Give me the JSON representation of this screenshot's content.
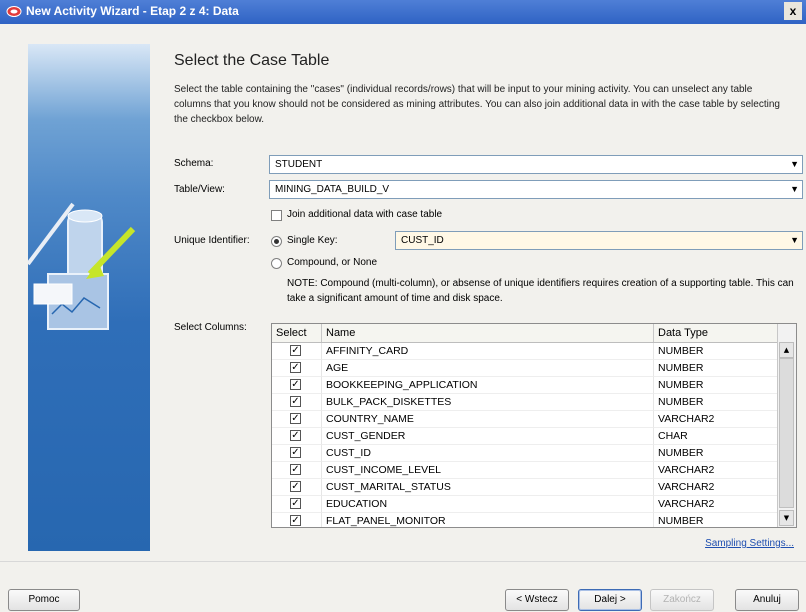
{
  "window": {
    "title": "New Activity Wizard - Etap 2 z 4: Data",
    "close_glyph": "x"
  },
  "heading": "Select the Case Table",
  "description": "Select the table containing the \"cases\" (individual records/rows) that will be input to your mining activity.  You can unselect any table columns that you know should not be considered as mining attributes.  You can also join additional data in with the case table by selecting the checkbox below.",
  "schema": {
    "label": "Schema:",
    "value": "STUDENT"
  },
  "table_view": {
    "label": "Table/View:",
    "value": "MINING_DATA_BUILD_V"
  },
  "join": {
    "label": "Join additional data with case table",
    "checked": false
  },
  "unique_identifier": {
    "label": "Unique Identifier:",
    "single_key_label": "Single Key:",
    "single_key_value": "CUST_ID",
    "compound_label": "Compound, or None",
    "selected": "single_key",
    "note": "NOTE: Compound (multi-column), or absense of unique identifiers requires creation of a supporting table. This can take a significant amount of time and disk space."
  },
  "select_columns": {
    "label": "Select Columns:",
    "headers": [
      "Select",
      "Name",
      "Data Type"
    ],
    "rows": [
      {
        "name": "AFFINITY_CARD",
        "type": "NUMBER",
        "selected": true
      },
      {
        "name": "AGE",
        "type": "NUMBER",
        "selected": true
      },
      {
        "name": "BOOKKEEPING_APPLICATION",
        "type": "NUMBER",
        "selected": true
      },
      {
        "name": "BULK_PACK_DISKETTES",
        "type": "NUMBER",
        "selected": true
      },
      {
        "name": "COUNTRY_NAME",
        "type": "VARCHAR2",
        "selected": true
      },
      {
        "name": "CUST_GENDER",
        "type": "CHAR",
        "selected": true
      },
      {
        "name": "CUST_ID",
        "type": "NUMBER",
        "selected": true
      },
      {
        "name": "CUST_INCOME_LEVEL",
        "type": "VARCHAR2",
        "selected": true
      },
      {
        "name": "CUST_MARITAL_STATUS",
        "type": "VARCHAR2",
        "selected": true
      },
      {
        "name": "EDUCATION",
        "type": "VARCHAR2",
        "selected": true
      },
      {
        "name": "FLAT_PANEL_MONITOR",
        "type": "NUMBER",
        "selected": true
      }
    ]
  },
  "sampling_link": "Sampling Settings...",
  "buttons": {
    "help": "Pomoc",
    "back": "< Wstecz",
    "next": "Dalej >",
    "finish": "Zakończ",
    "cancel": "Anuluj"
  },
  "icons": {
    "window": "oracle-app-icon",
    "dropdown": "chevron-down-icon",
    "checkmark": "checkmark-icon",
    "scroll_up": "arrow-up-icon",
    "scroll_down": "arrow-down-icon"
  }
}
